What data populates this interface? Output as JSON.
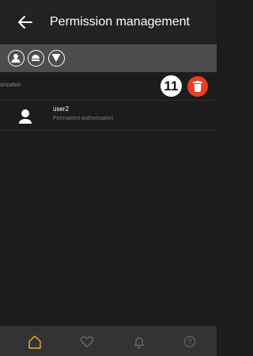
{
  "header": {
    "title": "Permission management",
    "back_icon": "back-arrow-icon"
  },
  "filters": [
    {
      "icon": "person-icon"
    },
    {
      "icon": "face-icon"
    },
    {
      "icon": "shield-icon"
    }
  ],
  "section": {
    "label": "orization",
    "count": "11"
  },
  "users": [
    {
      "name": "user2",
      "subtitle": "Permanent authorization",
      "icon": "user-avatar-icon"
    }
  ],
  "bottom_nav": [
    {
      "icon": "home-icon",
      "active": true
    },
    {
      "icon": "heart-icon",
      "active": false
    },
    {
      "icon": "bell-icon",
      "active": false
    },
    {
      "icon": "help-icon",
      "label": "?",
      "active": false
    }
  ],
  "colors": {
    "background": "#1c1c1c",
    "header": "#222222",
    "filter_bar": "#4c4c4c",
    "bottom_nav": "#333333",
    "accent": "#f2b422",
    "delete": "#ef3b24"
  }
}
